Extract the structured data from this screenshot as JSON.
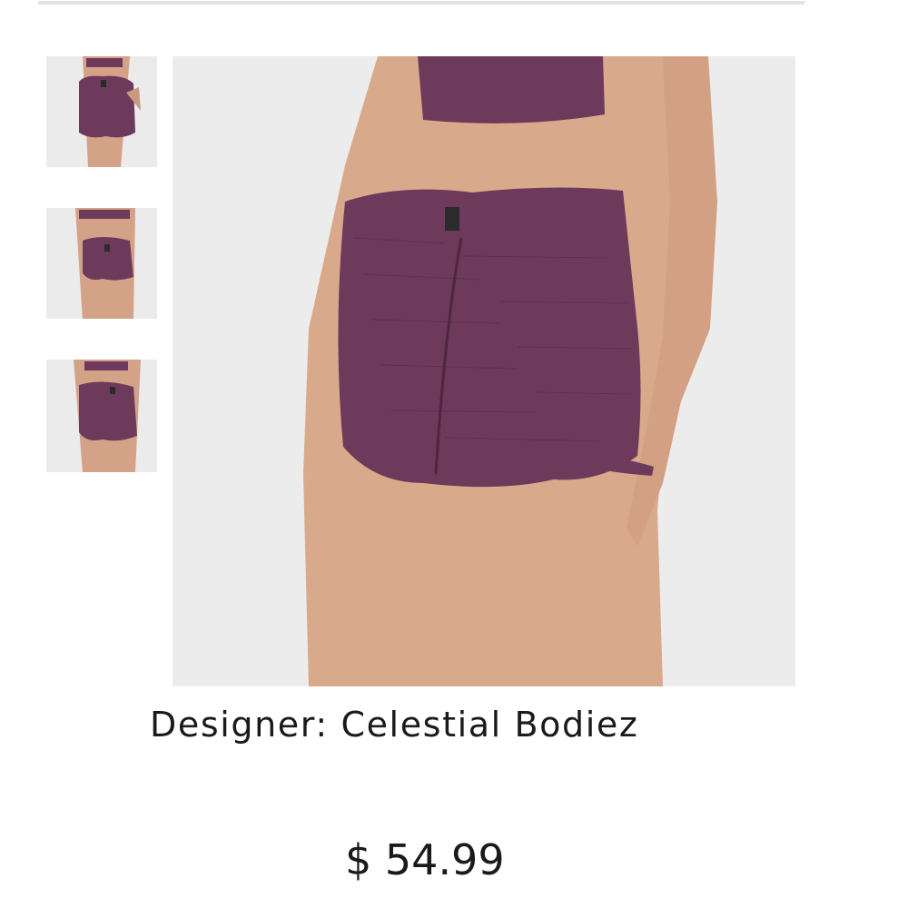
{
  "product": {
    "designer_label": "Designer:",
    "designer_name": "Celestial Bodiez",
    "price_currency": "$",
    "price_value": "54.99"
  },
  "gallery": {
    "thumbnails": [
      "shorts-back-view",
      "shorts-angled-view",
      "shorts-side-view"
    ],
    "main_image": "shorts-back-closeup"
  },
  "colors": {
    "fabric": "#6e3a5c",
    "background": "#ececec",
    "skin": "#d8a98c",
    "text": "#1a1a1a",
    "divider": "#e4e4e4"
  }
}
